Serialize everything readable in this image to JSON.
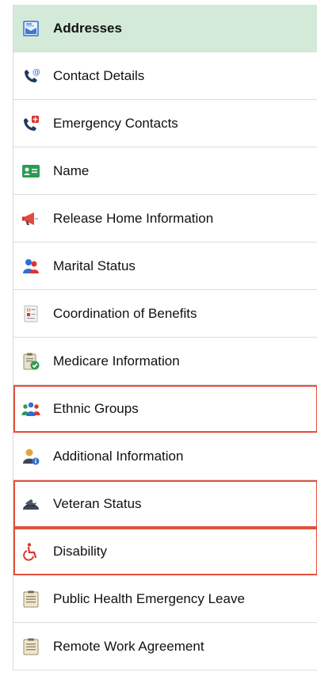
{
  "nav": {
    "items": [
      {
        "label": "Addresses",
        "icon": "address-card-icon",
        "active": true,
        "highlighted": false
      },
      {
        "label": "Contact Details",
        "icon": "phone-at-icon",
        "active": false,
        "highlighted": false
      },
      {
        "label": "Emergency Contacts",
        "icon": "emergency-phone-icon",
        "active": false,
        "highlighted": false
      },
      {
        "label": "Name",
        "icon": "id-card-icon",
        "active": false,
        "highlighted": false
      },
      {
        "label": "Release Home Information",
        "icon": "megaphone-icon",
        "active": false,
        "highlighted": false
      },
      {
        "label": "Marital Status",
        "icon": "people-icon",
        "active": false,
        "highlighted": false
      },
      {
        "label": "Coordination of Benefits",
        "icon": "benefits-document-icon",
        "active": false,
        "highlighted": false
      },
      {
        "label": "Medicare Information",
        "icon": "clipboard-check-icon",
        "active": false,
        "highlighted": false
      },
      {
        "label": "Ethnic Groups",
        "icon": "group-icon",
        "active": false,
        "highlighted": true
      },
      {
        "label": "Additional Information",
        "icon": "person-info-icon",
        "active": false,
        "highlighted": false
      },
      {
        "label": "Veteran Status",
        "icon": "veteran-cap-icon",
        "active": false,
        "highlighted": true
      },
      {
        "label": "Disability",
        "icon": "wheelchair-icon",
        "active": false,
        "highlighted": true
      },
      {
        "label": "Public Health Emergency Leave",
        "icon": "clipboard-icon",
        "active": false,
        "highlighted": false
      },
      {
        "label": "Remote Work Agreement",
        "icon": "clipboard-icon",
        "active": false,
        "highlighted": false
      }
    ]
  },
  "colors": {
    "active_bg": "#d4ead9",
    "highlight_border": "#e0513d",
    "divider": "#dcdcdc"
  }
}
